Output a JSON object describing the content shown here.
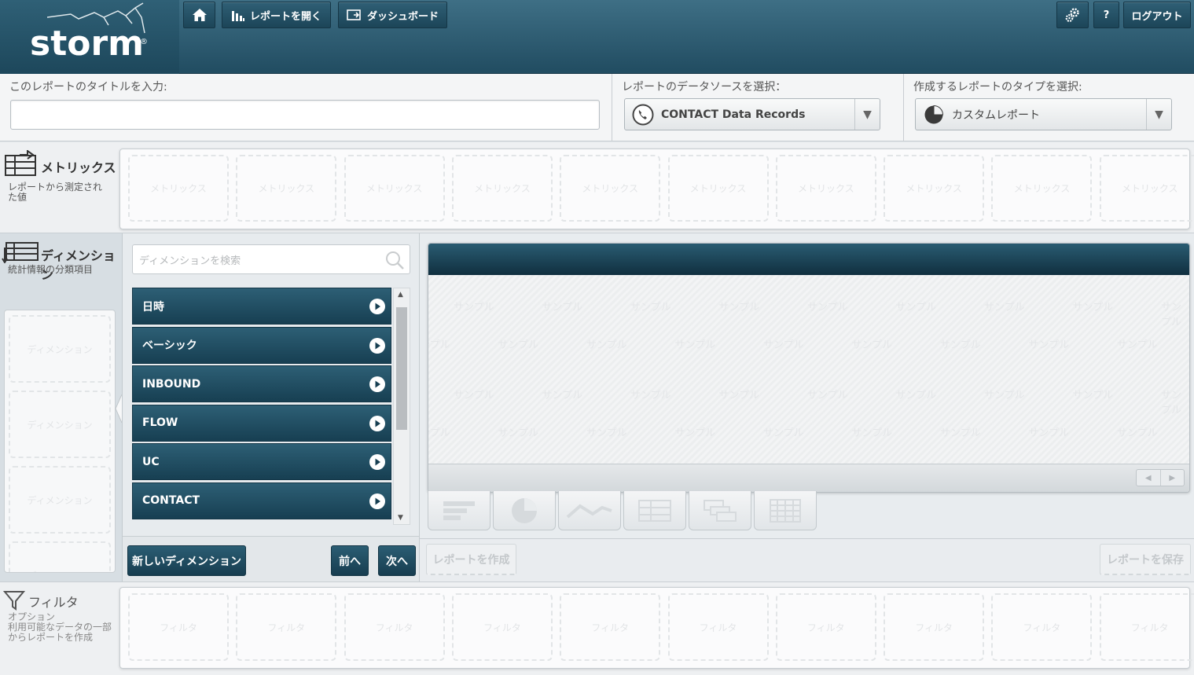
{
  "header": {
    "logo_text": "storm",
    "logo_reg": "®",
    "nav": {
      "home_icon": "home-icon",
      "open_report": "レポートを開く",
      "dashboard": "ダッシュボード",
      "settings_icon": "gears-icon",
      "help": "?",
      "logout": "ログアウト"
    }
  },
  "report_form": {
    "title_label": "このレポートのタイトルを入力:",
    "title_value": "",
    "datasource_label": "レポートのデータソースを選択：",
    "datasource_value": "CONTACT Data Records",
    "datasource_icon": "phone-icon",
    "type_label": "作成するレポートのタイプを選択:",
    "type_value": "カスタムレポート",
    "type_icon": "pie-chart-icon"
  },
  "metrics": {
    "title": "メトリックス",
    "description": "レポートから測定された値",
    "slot_placeholder": "メトリックス",
    "slot_count": 10
  },
  "dimensions": {
    "title": "ディメンション",
    "description": "統計情報の分類項目",
    "slot_placeholder": "ディメンション",
    "search_placeholder": "ディメンションを検索",
    "items": [
      "日時",
      "ベーシック",
      "INBOUND",
      "FLOW",
      "UC",
      "CONTACT"
    ],
    "new_button": "新しいディメンション",
    "prev_button": "前へ",
    "next_button": "次へ"
  },
  "preview": {
    "watermark": "サンプル",
    "chart_types": [
      "bar-chart-icon",
      "pie-chart-icon",
      "line-chart-icon",
      "table-icon",
      "pivot-table-icon",
      "grid-table-icon"
    ],
    "create_button": "レポートを作成",
    "save_button": "レポートを保存"
  },
  "filters": {
    "title": "フィルタ",
    "description": "オプション\n利用可能なデータの一部からレポートを作成",
    "slot_placeholder": "フィルタ",
    "slot_count": 10
  },
  "colors": {
    "header_top": "#3e6f85",
    "header_bottom": "#214c61",
    "button_dark": "#173f52"
  }
}
